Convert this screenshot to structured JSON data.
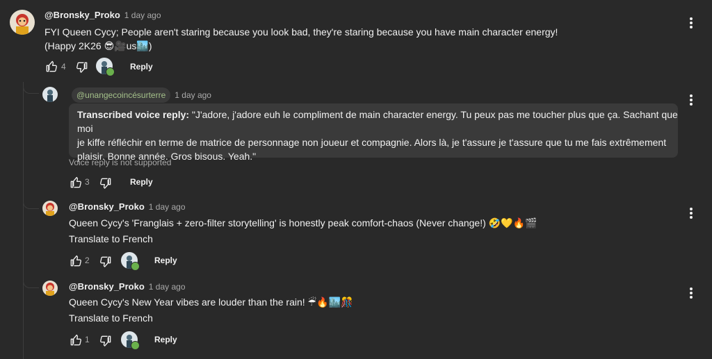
{
  "comments": [
    {
      "author": "@Bronsky_Proko",
      "time": "1 day ago",
      "line1": "FYI Queen Cycy; People aren't staring because you look bad, they're staring because you have main character energy!",
      "line2": "(Happy 2K26 😎🎥us🏙️)",
      "likes": "4",
      "reply_label": "Reply"
    },
    {
      "author": "@unangecoincésurterre",
      "time": "1 day ago",
      "voice_prefix": "Transcribed voice reply:",
      "voice_line1": " \"J'adore, j'adore euh le compliment de main character energy. Tu peux pas me toucher plus que ça. Sachant que moi",
      "voice_line2": "je kiffe réfléchir en terme de matrice de personnage non joueur et compagnie. Alors là, je t'assure je t'assure que tu me fais extrêmement",
      "voice_line3": "plaisir. Bonne année. Gros bisous. Yeah.\"",
      "notice": "Voice reply is not supported",
      "likes": "3",
      "reply_label": "Reply"
    },
    {
      "author": "@Bronsky_Proko",
      "time": "1 day ago",
      "text": "Queen Cycy's 'Franglais + zero-filter storytelling' is honestly peak comfort-chaos (Never change!) 🤣💛🔥🎬",
      "translate": "Translate to French",
      "likes": "2",
      "reply_label": "Reply"
    },
    {
      "author": "@Bronsky_Proko",
      "time": "1 day ago",
      "text": "Queen Cycy's New Year vibes are louder than the rain! ☔🔥🏙️🎊",
      "translate": "Translate to French",
      "likes": "1",
      "reply_label": "Reply"
    }
  ],
  "icons": [
    "thumbs-up-icon",
    "thumbs-down-icon",
    "more-vert-icon",
    "creator-heart-icon"
  ],
  "colors": {
    "background": "#292929",
    "chip": "#3a3a3a",
    "chip_text": "#a4c08a",
    "muted": "#aaaaaa",
    "heart": "#6ab04c"
  }
}
